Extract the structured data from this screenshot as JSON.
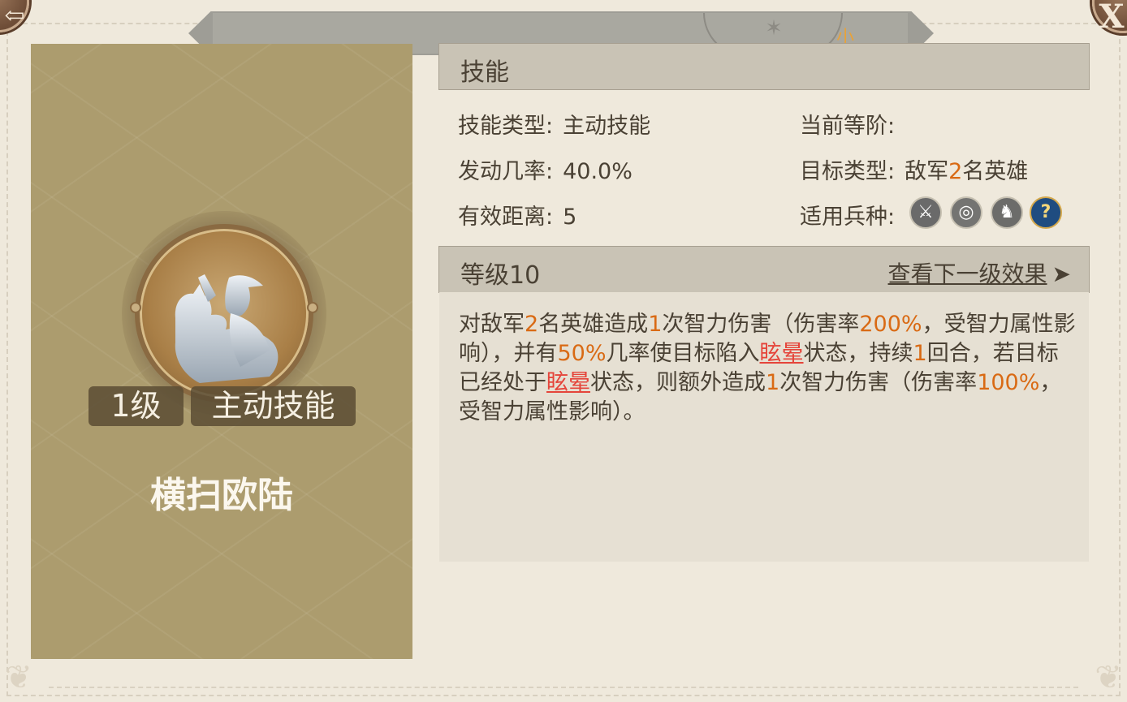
{
  "header": {
    "banner_text": "小"
  },
  "buttons": {
    "back_glyph": "⇦",
    "close_glyph": "X"
  },
  "left": {
    "level_badge": "1级",
    "type_badge": "主动技能",
    "skill_name": "横扫欧陆"
  },
  "skill_section": {
    "title": "技能",
    "rows": {
      "skill_type": {
        "label": "技能类型:",
        "value": "主动技能"
      },
      "current_tier": {
        "label": "当前等阶:",
        "value": ""
      },
      "trigger_rate": {
        "label": "发动几率:",
        "value": "40.0%"
      },
      "target_type": {
        "label": "目标类型:",
        "value_prefix": "敌军",
        "value_num": "2",
        "value_suffix": "名英雄"
      },
      "range": {
        "label": "有效距离:",
        "value": "5"
      },
      "troop_types": {
        "label": "适用兵种:"
      }
    },
    "troop_icons": [
      "sword-icon",
      "target-icon",
      "horse-icon",
      "question-icon"
    ]
  },
  "level_section": {
    "title": "等级10",
    "next_link": "查看下一级效果",
    "next_arrow": "➤"
  },
  "description": {
    "parts": [
      {
        "t": "对敌军",
        "s": "n"
      },
      {
        "t": "2",
        "s": "h"
      },
      {
        "t": "名英雄造成",
        "s": "n"
      },
      {
        "t": "1",
        "s": "h"
      },
      {
        "t": "次智力伤害（伤害率",
        "s": "n"
      },
      {
        "t": "200%",
        "s": "h"
      },
      {
        "t": "，受智力属性影响），并有",
        "s": "n"
      },
      {
        "t": "50%",
        "s": "h"
      },
      {
        "t": "几率使目标陷入",
        "s": "n"
      },
      {
        "t": "眩晕",
        "s": "r"
      },
      {
        "t": "状态，持续",
        "s": "n"
      },
      {
        "t": "1",
        "s": "h"
      },
      {
        "t": "回合，若目标已经处于",
        "s": "n"
      },
      {
        "t": "眩晕",
        "s": "r"
      },
      {
        "t": "状态，则额外造成",
        "s": "n"
      },
      {
        "t": "1",
        "s": "h"
      },
      {
        "t": "次智力伤害（伤害率",
        "s": "n"
      },
      {
        "t": "100%",
        "s": "h"
      },
      {
        "t": "，受智力属性影响）。",
        "s": "n"
      }
    ]
  },
  "colors": {
    "highlight": "#d96a14",
    "status_red": "#e5443a",
    "left_panel": "#ac9c6e",
    "header_bg": "#c9c3b5"
  }
}
